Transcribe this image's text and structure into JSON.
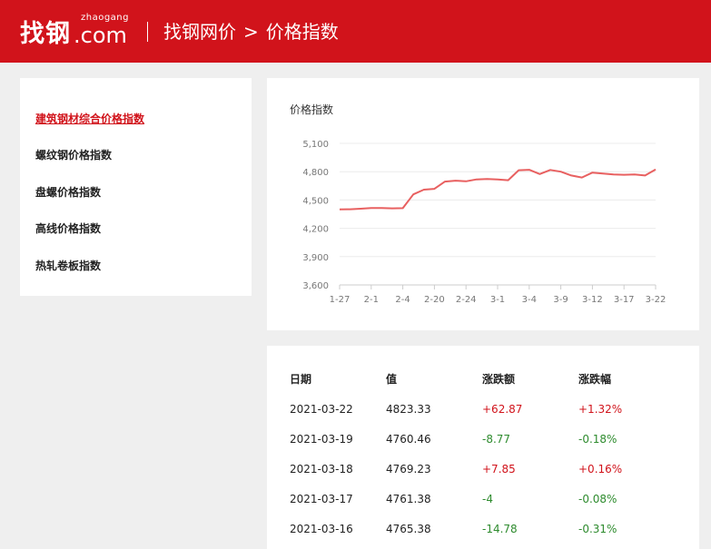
{
  "header": {
    "logo_cn": "找钢",
    "logo_en": ".com",
    "logo_sub": "zhaogang",
    "breadcrumb": [
      "找钢网价",
      ">",
      "价格指数"
    ]
  },
  "sidebar": {
    "items": [
      {
        "label": "建筑钢材综合价格指数",
        "active": true
      },
      {
        "label": "螺纹钢价格指数",
        "active": false
      },
      {
        "label": "盘螺价格指数",
        "active": false
      },
      {
        "label": "高线价格指数",
        "active": false
      },
      {
        "label": "热轧卷板指数",
        "active": false
      }
    ]
  },
  "chart_data": {
    "type": "line",
    "title": "价格指数",
    "ylim": [
      3600,
      5100
    ],
    "yticks": [
      "5,100",
      "4,800",
      "4,500",
      "4,200",
      "3,900",
      "3,600"
    ],
    "ytick_values": [
      5100,
      4800,
      4500,
      4200,
      3900,
      3600
    ],
    "xtick_labels": [
      "1-27",
      "2-1",
      "2-4",
      "2-20",
      "2-24",
      "3-1",
      "3-4",
      "3-9",
      "3-12",
      "3-17",
      "3-22"
    ],
    "xtick_positions": [
      0,
      3,
      6,
      9,
      12,
      15,
      18,
      21,
      24,
      27,
      30
    ],
    "values": [
      4400,
      4402,
      4408,
      4415,
      4415,
      4412,
      4413,
      4560,
      4610,
      4618,
      4695,
      4705,
      4698,
      4718,
      4722,
      4718,
      4710,
      4815,
      4820,
      4775,
      4818,
      4800,
      4760,
      4738,
      4790,
      4780,
      4770,
      4767,
      4770,
      4760,
      4823
    ],
    "line_color": "#e86060",
    "grid": true
  },
  "table": {
    "headers": [
      "日期",
      "值",
      "涨跌额",
      "涨跌幅"
    ],
    "rows": [
      {
        "date": "2021-03-22",
        "value": "4823.33",
        "change": "+62.87",
        "pct": "+1.32%",
        "dir": "up"
      },
      {
        "date": "2021-03-19",
        "value": "4760.46",
        "change": "-8.77",
        "pct": "-0.18%",
        "dir": "down"
      },
      {
        "date": "2021-03-18",
        "value": "4769.23",
        "change": "+7.85",
        "pct": "+0.16%",
        "dir": "up"
      },
      {
        "date": "2021-03-17",
        "value": "4761.38",
        "change": "-4",
        "pct": "-0.08%",
        "dir": "down"
      },
      {
        "date": "2021-03-16",
        "value": "4765.38",
        "change": "-14.78",
        "pct": "-0.31%",
        "dir": "down"
      }
    ]
  },
  "colors": {
    "brand": "#d1131b",
    "up": "#d1131b",
    "down": "#2e8b2e"
  }
}
